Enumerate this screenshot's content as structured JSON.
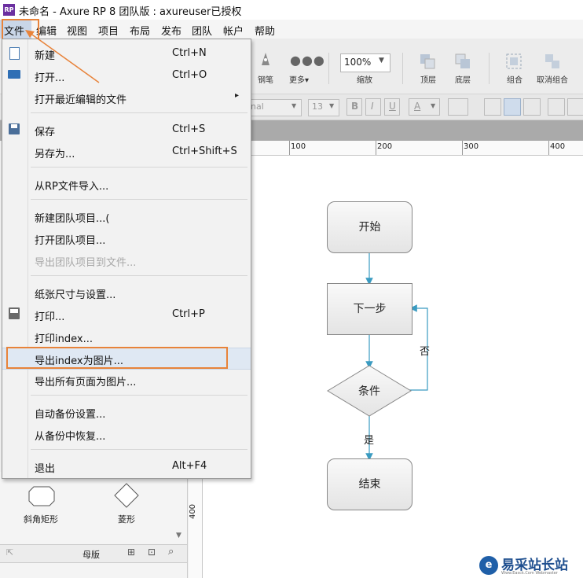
{
  "window": {
    "title": "未命名 - Axure RP 8 团队版 : axureuser已授权",
    "logo_text": "RP"
  },
  "menubar": {
    "items": [
      "文件",
      "编辑",
      "视图",
      "项目",
      "布局",
      "发布",
      "团队",
      "帐户",
      "帮助"
    ]
  },
  "toolbar": {
    "pen_label": "钢笔",
    "more_label": "更多▾",
    "zoom_value": "100%",
    "zoom_label": "缩放",
    "top_label": "顶层",
    "bottom_label": "底层",
    "group_label": "组合",
    "ungroup_label": "取消组合"
  },
  "formatbar": {
    "font_value": "nal",
    "size_value": "13",
    "bold": "B",
    "italic": "I",
    "underline": "U",
    "font_color": "A"
  },
  "ruler": {
    "h_ticks": [
      "100",
      "200",
      "300",
      "400"
    ],
    "v_tick": "400"
  },
  "file_menu": {
    "items": [
      {
        "label": "新建",
        "shortcut": "Ctrl+N"
      },
      {
        "label": "打开...",
        "shortcut": "Ctrl+O"
      },
      {
        "label": "打开最近编辑的文件",
        "shortcut": "",
        "submenu_arrow": "▸"
      },
      {
        "label": "保存",
        "shortcut": "Ctrl+S"
      },
      {
        "label": "另存为...",
        "shortcut": "Ctrl+Shift+S"
      },
      {
        "label": "从RP文件导入...",
        "shortcut": ""
      },
      {
        "label": "新建团队项目...(",
        "shortcut": ""
      },
      {
        "label": "打开团队项目...",
        "shortcut": ""
      },
      {
        "label": "导出团队项目到文件...",
        "shortcut": "",
        "disabled": true
      },
      {
        "label": "纸张尺寸与设置...",
        "shortcut": ""
      },
      {
        "label": "打印...",
        "shortcut": "Ctrl+P"
      },
      {
        "label": "打印index...",
        "shortcut": ""
      },
      {
        "label": "导出index为图片...",
        "shortcut": "",
        "highlighted": true
      },
      {
        "label": "导出所有页面为图片...",
        "shortcut": ""
      },
      {
        "label": "自动备份设置...",
        "shortcut": ""
      },
      {
        "label": "从备份中恢复...",
        "shortcut": ""
      },
      {
        "label": "退出",
        "shortcut": "Alt+F4"
      }
    ]
  },
  "flowchart": {
    "start": "开始",
    "next": "下一步",
    "condition": "条件",
    "end": "结束",
    "yes": "是",
    "no": "否"
  },
  "left_panel": {
    "shape1": "斜角矩形",
    "shape2": "菱形",
    "masters_label": "母版"
  },
  "watermark": {
    "text": "易采站长站",
    "sub": "Www.Easck.Com Webmaster"
  },
  "colors": {
    "highlight_border": "#e8833a",
    "connector": "#3a9bc1",
    "logo": "#6b2fa0"
  }
}
